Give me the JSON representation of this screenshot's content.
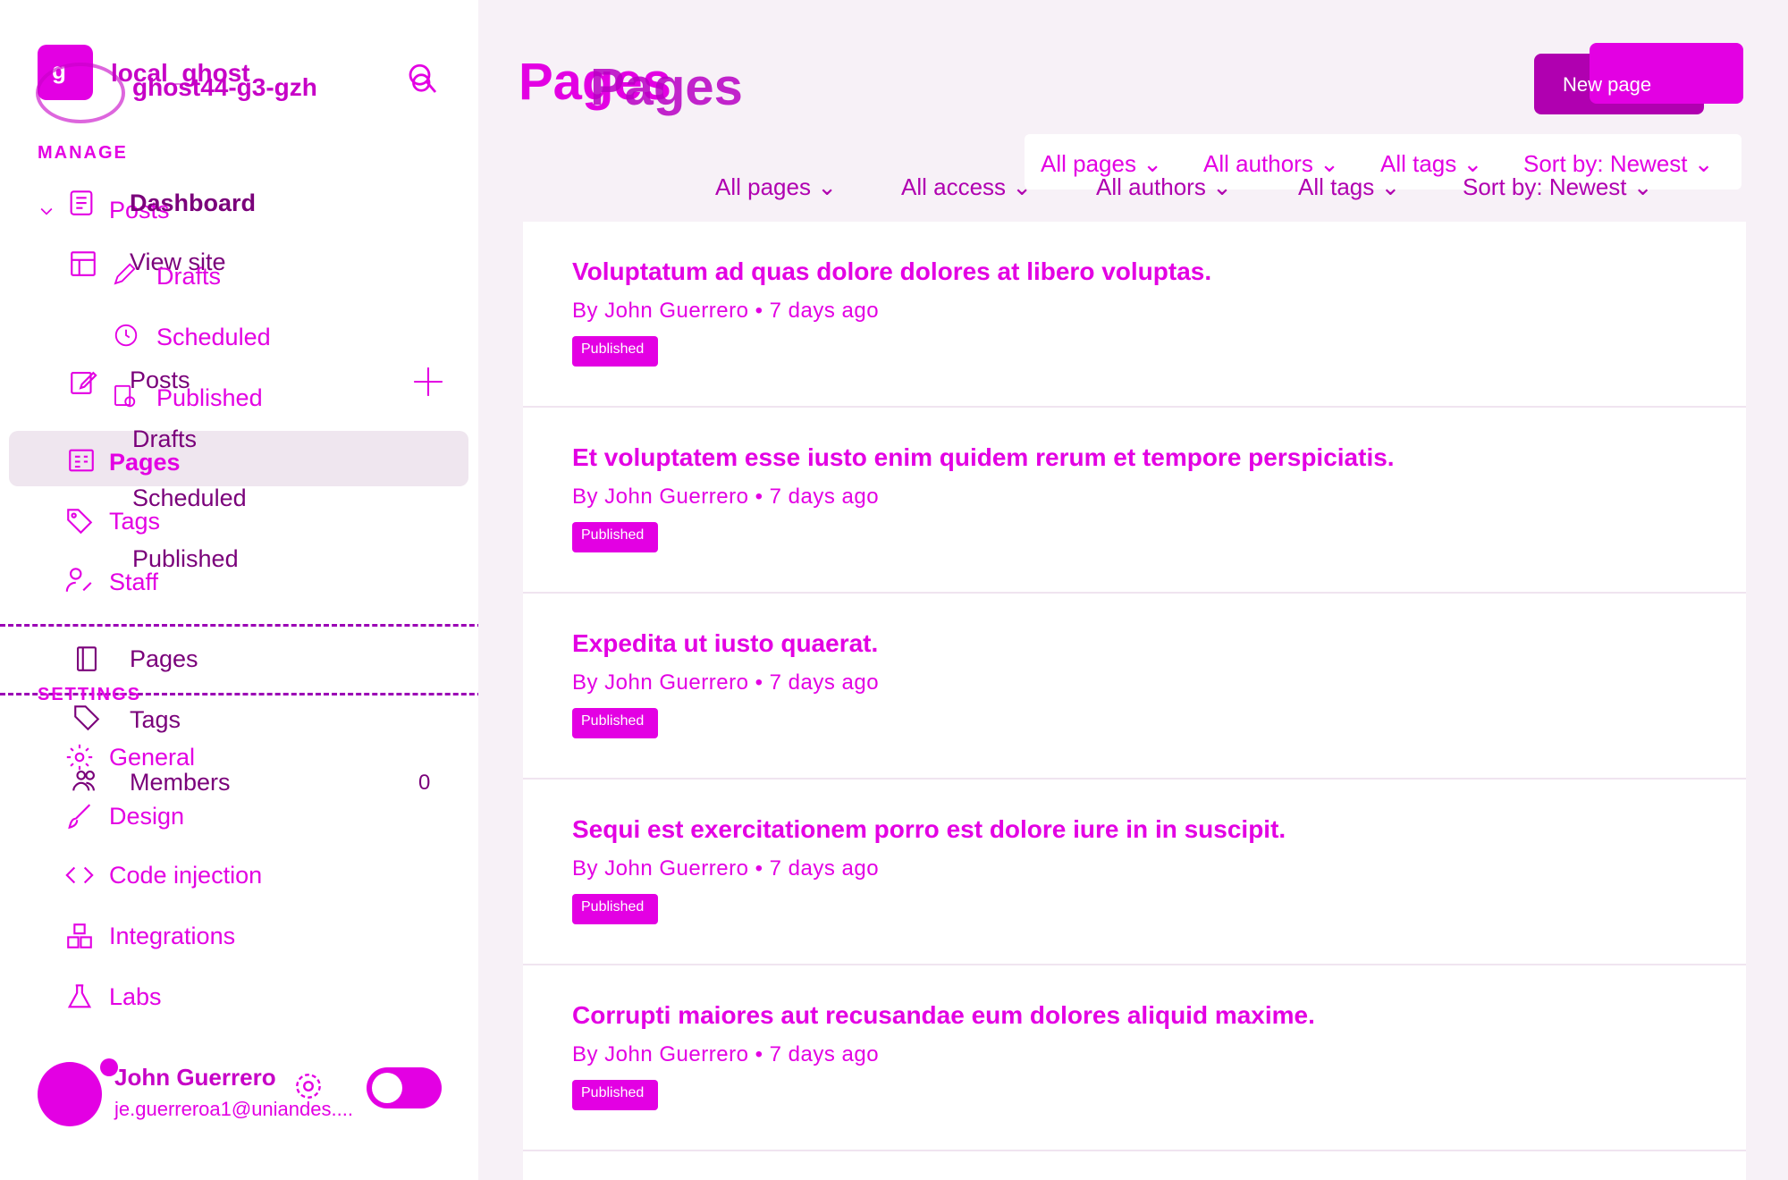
{
  "app": {
    "site_name": "local_ghost",
    "site_subdomain": "ghost44-g3-gzh",
    "logo_letter": "g"
  },
  "sidebar": {
    "manage_label": "MANAGE",
    "settings_label": "SETTINGS",
    "nav": {
      "posts": "Posts",
      "drafts": "Drafts",
      "scheduled": "Scheduled",
      "published": "Published",
      "pages": "Pages",
      "tags": "Tags",
      "staff": "Staff",
      "general": "General",
      "design": "Design",
      "code_injection": "Code injection",
      "integrations": "Integrations",
      "labs": "Labs"
    },
    "overlay_nav": {
      "dashboard": "Dashboard",
      "view_site": "View site",
      "posts": "Posts",
      "drafts": "Drafts",
      "scheduled": "Scheduled",
      "published": "Published",
      "pages": "Pages",
      "tags": "Tags",
      "members": "Members",
      "members_count": "0"
    },
    "user": {
      "name": "John Guerrero",
      "email": "je.guerreroa1@uniandes...."
    }
  },
  "main": {
    "title": "Pages",
    "new_page_label": "New page",
    "filters_top": [
      "All pages",
      "All authors",
      "All tags",
      "Sort by: Newest"
    ],
    "filters_bottom": [
      "All pages",
      "All access",
      "All authors",
      "All tags",
      "Sort by: Newest"
    ],
    "items": [
      {
        "title": "Voluptatum ad quas dolore dolores at libero voluptas.",
        "meta": "By John Guerrero • 7 days ago",
        "status": "Published"
      },
      {
        "title": "Et voluptatem esse iusto enim quidem rerum et tempore perspiciatis.",
        "meta": "By John Guerrero • 7 days ago",
        "status": "Published"
      },
      {
        "title": "Expedita ut iusto quaerat.",
        "meta": "By John Guerrero • 7 days ago",
        "status": "Published"
      },
      {
        "title": "Sequi est exercitationem porro est dolore iure in in suscipit.",
        "meta": "By John Guerrero • 7 days ago",
        "status": "Published"
      },
      {
        "title": "Corrupti maiores aut recusandae eum dolores aliquid maxime.",
        "meta": "By John Guerrero • 7 days ago",
        "status": "Published"
      }
    ]
  },
  "colors": {
    "accent": "#e300e3",
    "accent_dark": "#7a007a",
    "background": "#f7f1f7"
  },
  "icons": [
    "ghost-logo-icon",
    "search-icon",
    "posts-icon",
    "layout-icon",
    "pencil-icon",
    "clock-icon",
    "edit-icon",
    "published-icon",
    "plus-icon",
    "pages-icon",
    "tag-icon",
    "staff-icon",
    "gear-icon",
    "members-icon",
    "brush-icon",
    "code-icon",
    "integrations-icon",
    "flask-icon",
    "chevron-down-icon"
  ]
}
